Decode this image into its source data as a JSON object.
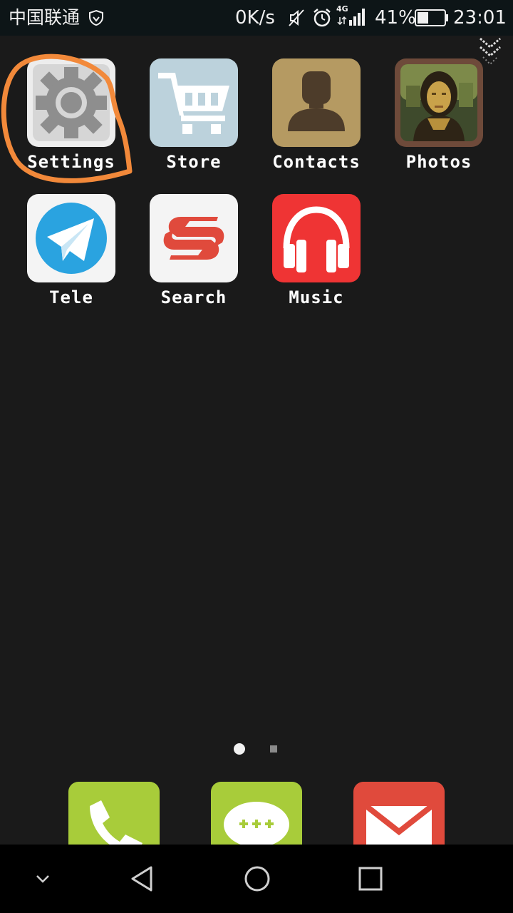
{
  "status_bar": {
    "carrier": "中国联通",
    "net_speed": "0K/s",
    "network_type": "4G",
    "battery_percent": "41%",
    "battery_level": 0.41,
    "time": "23:01"
  },
  "apps": [
    {
      "label": "Settings",
      "icon": "settings-gear-icon"
    },
    {
      "label": "Store",
      "icon": "shopping-cart-icon"
    },
    {
      "label": "Contacts",
      "icon": "contact-person-icon"
    },
    {
      "label": "Photos",
      "icon": "mona-lisa-photo-icon"
    },
    {
      "label": "Tele",
      "icon": "telegram-plane-icon"
    },
    {
      "label": "Search",
      "icon": "search-s-icon"
    },
    {
      "label": "Music",
      "icon": "headphones-icon"
    }
  ],
  "page_indicator": {
    "current": 1,
    "total": 2
  },
  "dock": [
    {
      "icon": "phone-icon",
      "color": "#a8cc3a"
    },
    {
      "icon": "messages-icon",
      "color": "#a8cc3a"
    },
    {
      "icon": "mail-icon",
      "color": "#e04a3c"
    }
  ],
  "nav_bar": [
    "collapse-icon",
    "back-icon",
    "home-icon",
    "recents-icon"
  ],
  "colors": {
    "background": "#1a1a1a",
    "annotation": "#f2893a",
    "music": "#ef3434",
    "tele": "#2aa3e0",
    "store": "#bcd2dc",
    "contacts": "#b59a62"
  }
}
